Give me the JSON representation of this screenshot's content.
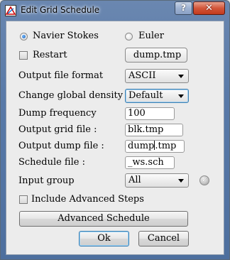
{
  "window": {
    "title": "Edit Grid Schedule",
    "help_glyph": "?",
    "close_glyph": "✕"
  },
  "solver": {
    "option1": "Navier Stokes",
    "option2": "Euler",
    "selected": "Navier Stokes"
  },
  "restart": {
    "label": "Restart",
    "checked": false,
    "file": "dump.tmp"
  },
  "form": {
    "output_format_label": "Output file format",
    "output_format_value": "ASCII",
    "density_label": "Change global density",
    "density_value": "Default",
    "dump_freq_label": "Dump frequency",
    "dump_freq_value": "100",
    "grid_file_label": "Output grid file :",
    "grid_file_value": "blk.tmp",
    "dump_file_label": "Output dump file :",
    "dump_file_value_pre": "dump",
    "dump_file_value_post": ".tmp",
    "schedule_label": "Schedule file :",
    "schedule_value": "_ws.sch",
    "input_group_label": "Input group",
    "input_group_value": "All",
    "advanced_steps_label": "Include Advanced Steps",
    "advanced_steps_checked": false
  },
  "buttons": {
    "advanced": "Advanced Schedule",
    "ok": "Ok",
    "cancel": "Cancel"
  },
  "icons": {
    "app": "grid-schedule-icon",
    "validate": "checkmark-icon"
  },
  "colors": {
    "title_gradient": "#5879a8",
    "close_button": "#c23a1e",
    "focus_border": "#3c7fb1",
    "radio_fill": "#1c5fb4"
  }
}
